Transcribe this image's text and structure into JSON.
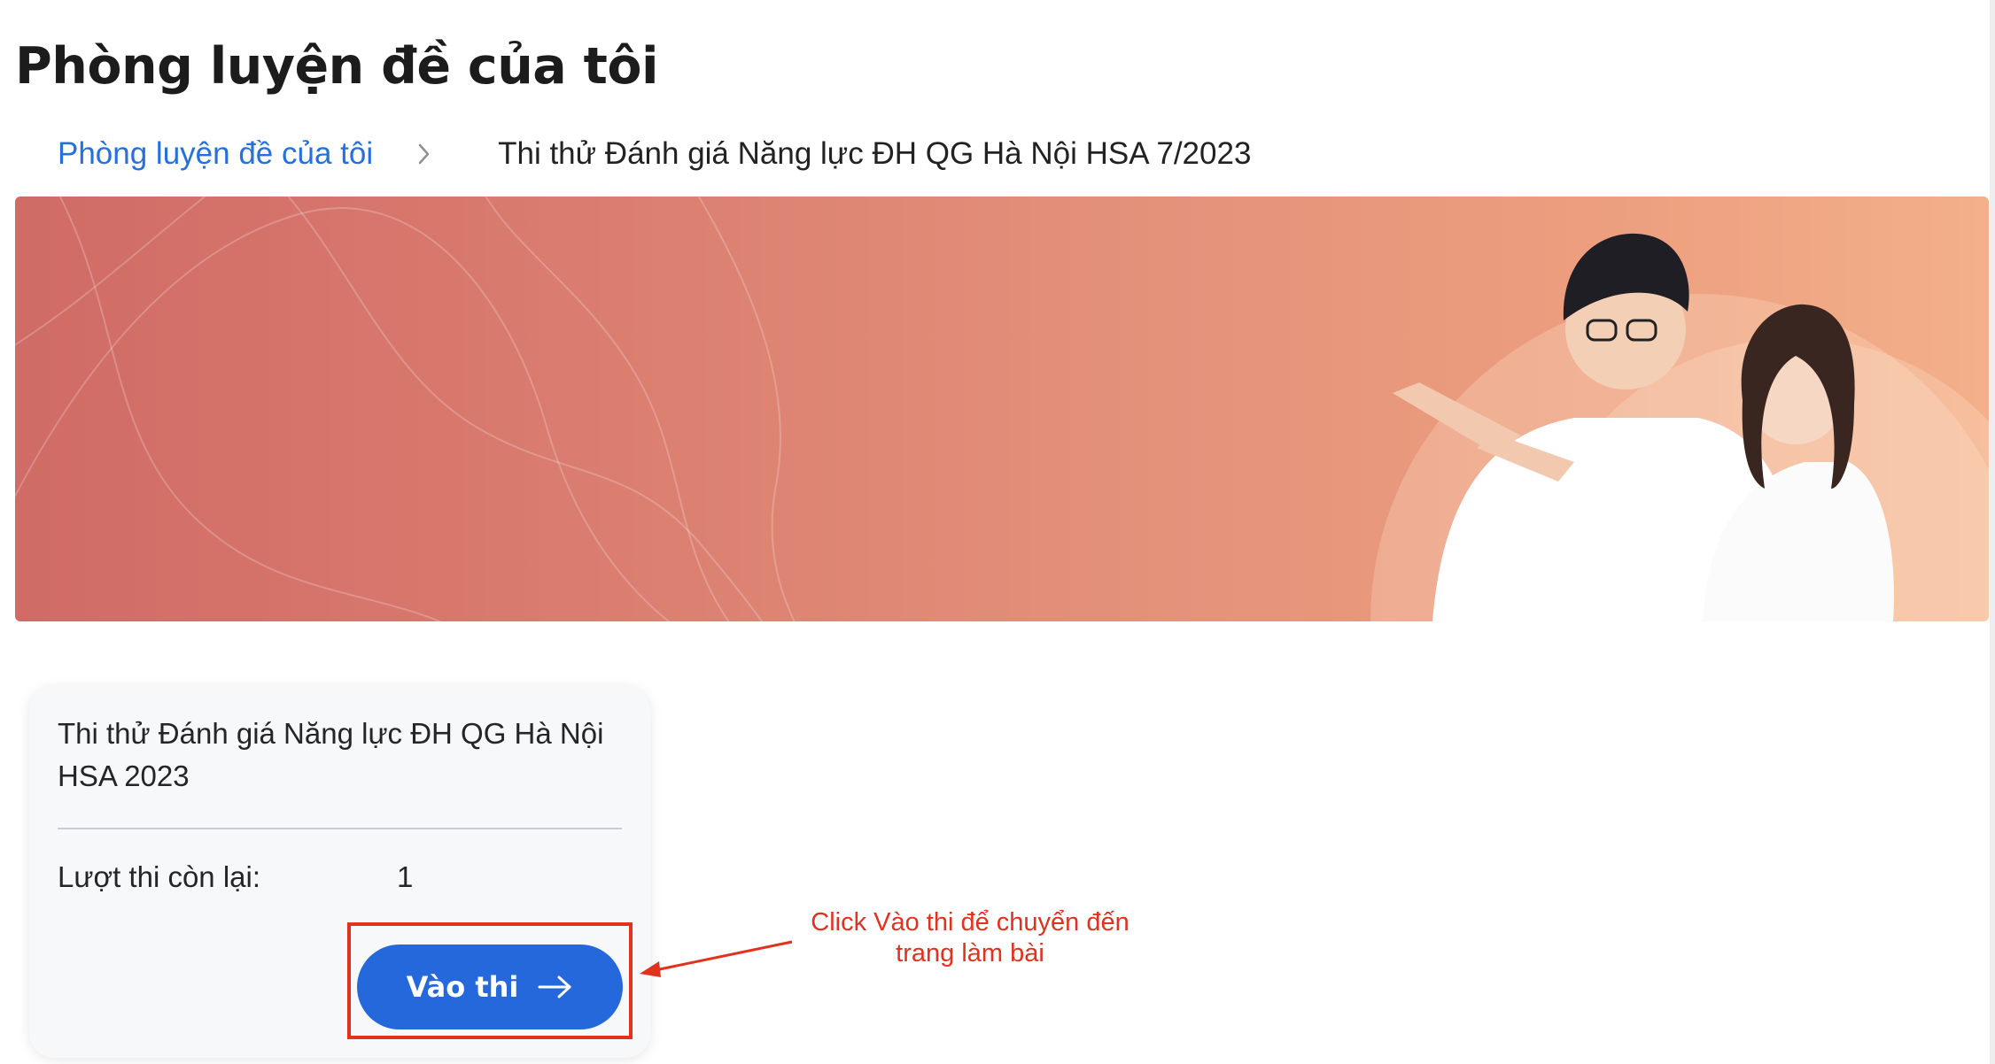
{
  "page": {
    "title": "Phòng luyện đề của tôi"
  },
  "breadcrumb": {
    "parent_label": "Phòng luyện đề của tôi",
    "separator_icon": "chevron-right-icon",
    "current_label": "Thi thử Đánh giá Năng lực ĐH QG Hà Nội HSA 7/2023"
  },
  "banner": {
    "gradient_colors": [
      "#d06b66",
      "#e3907a",
      "#f3b08a"
    ]
  },
  "exam_card": {
    "title": "Thi thử Đánh giá Năng lực ĐH QG Hà Nội HSA 2023",
    "attempts_label": "Lượt thi còn lại:",
    "attempts_value": "1",
    "enter_button_label": "Vào thi",
    "enter_button_icon": "arrow-right-icon"
  },
  "annotation": {
    "line1": "Click Vào thi để chuyển đến",
    "line2": "trang làm bài",
    "color": "#e0321f"
  },
  "colors": {
    "link": "#2670dc",
    "primary_button": "#2468db",
    "annotation_red": "#e0321f"
  }
}
